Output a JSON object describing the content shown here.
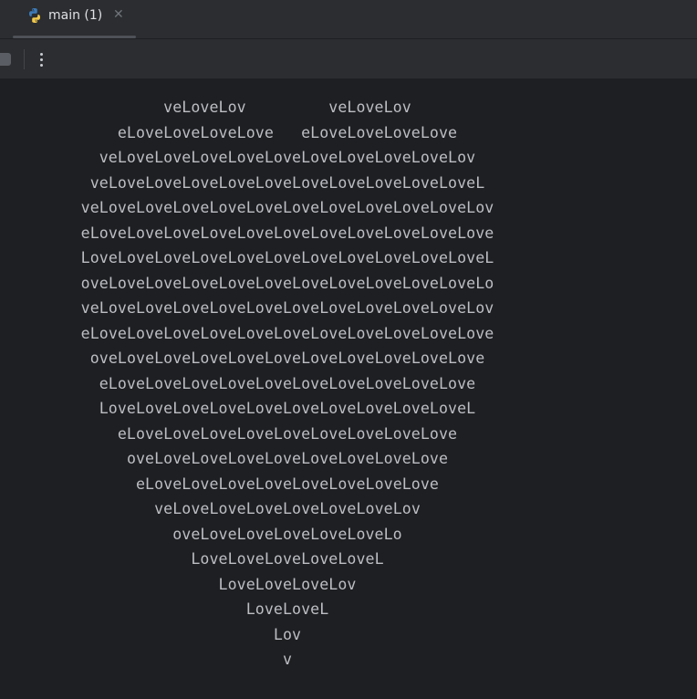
{
  "tab": {
    "title": "main (1)",
    "icon": "python-icon",
    "close_icon": "close-icon"
  },
  "toolbar": {
    "stop_icon": "stop-icon",
    "more_icon": "more-vertical-icon"
  },
  "console": {
    "lines": [
      "veLoveLov         veLoveLov",
      "eLoveLoveLoveLove   eLoveLoveLoveLove",
      "veLoveLoveLoveLoveLoveLoveLoveLoveLoveLov",
      "veLoveLoveLoveLoveLoveLoveLoveLoveLoveLoveL",
      "veLoveLoveLoveLoveLoveLoveLoveLoveLoveLoveLov",
      "eLoveLoveLoveLoveLoveLoveLoveLoveLoveLoveLove",
      "LoveLoveLoveLoveLoveLoveLoveLoveLoveLoveLoveL",
      "oveLoveLoveLoveLoveLoveLoveLoveLoveLoveLoveLo",
      "veLoveLoveLoveLoveLoveLoveLoveLoveLoveLoveLov",
      "eLoveLoveLoveLoveLoveLoveLoveLoveLoveLoveLove",
      "oveLoveLoveLoveLoveLoveLoveLoveLoveLoveLove",
      "eLoveLoveLoveLoveLoveLoveLoveLoveLoveLove",
      "LoveLoveLoveLoveLoveLoveLoveLoveLoveLoveL",
      "eLoveLoveLoveLoveLoveLoveLoveLoveLove",
      "oveLoveLoveLoveLoveLoveLoveLoveLove",
      "eLoveLoveLoveLoveLoveLoveLoveLove",
      "veLoveLoveLoveLoveLoveLoveLov",
      "oveLoveLoveLoveLoveLoveLo",
      "LoveLoveLoveLoveLoveL",
      "LoveLoveLoveLov",
      "LoveLoveL",
      "Lov",
      "v"
    ]
  }
}
